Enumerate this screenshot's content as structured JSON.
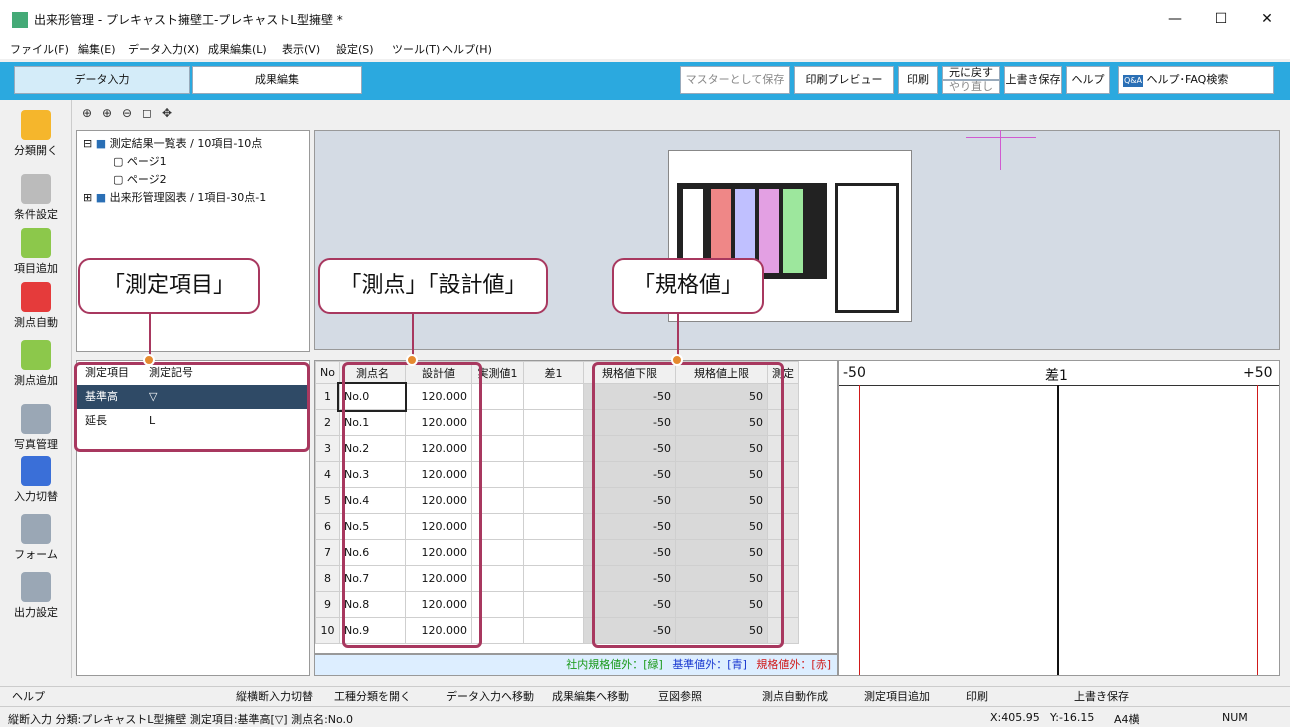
{
  "window": {
    "title": "出来形管理 - プレキャスト擁壁工-プレキャストL型擁壁 *"
  },
  "menu": [
    "ファイル(F)",
    "編集(E)",
    "データ入力(X)",
    "成果編集(L)",
    "表示(V)",
    "設定(S)",
    "ツール(T)",
    "ヘルプ(H)"
  ],
  "toolbar": {
    "tab_data_input": "データ入力",
    "tab_result_edit": "成果編集",
    "save_master": "マスターとして保存",
    "print_preview": "印刷プレビュー",
    "print": "印刷",
    "undo": "元に戻す",
    "redo": "やり直し",
    "overwrite_save": "上書き保存",
    "help": "ヘルプ",
    "faq_search": "ヘルプ･FAQ検索",
    "faq_badge": "Q&A"
  },
  "sidebar": [
    "分類開く",
    "条件設定",
    "項目追加",
    "測点自動",
    "測点追加",
    "写真管理",
    "入力切替",
    "フォーム",
    "出力設定"
  ],
  "tree": {
    "node1": "測定結果一覧表 / 10項目-10点",
    "page1": "ページ1",
    "page2": "ページ2",
    "node2": "出来形管理図表 / 1項目-30点-1"
  },
  "items": {
    "headers": [
      "測定項目",
      "測定記号"
    ],
    "rows": [
      [
        "基準高",
        "▽"
      ],
      [
        "延長",
        "L"
      ]
    ]
  },
  "grid": {
    "headers": [
      "No",
      "測点名",
      "設計値",
      "実測値1",
      "差1",
      "規格値下限",
      "規格値上限",
      "測定"
    ],
    "rows": [
      [
        "1",
        "No.0",
        "120.000",
        "",
        "",
        "-50",
        "50"
      ],
      [
        "2",
        "No.1",
        "120.000",
        "",
        "",
        "-50",
        "50"
      ],
      [
        "3",
        "No.2",
        "120.000",
        "",
        "",
        "-50",
        "50"
      ],
      [
        "4",
        "No.3",
        "120.000",
        "",
        "",
        "-50",
        "50"
      ],
      [
        "5",
        "No.4",
        "120.000",
        "",
        "",
        "-50",
        "50"
      ],
      [
        "6",
        "No.5",
        "120.000",
        "",
        "",
        "-50",
        "50"
      ],
      [
        "7",
        "No.6",
        "120.000",
        "",
        "",
        "-50",
        "50"
      ],
      [
        "8",
        "No.7",
        "120.000",
        "",
        "",
        "-50",
        "50"
      ],
      [
        "9",
        "No.8",
        "120.000",
        "",
        "",
        "-50",
        "50"
      ],
      [
        "10",
        "No.9",
        "120.000",
        "",
        "",
        "-50",
        "50"
      ]
    ]
  },
  "legend": {
    "green": "社内規格値外：[緑]",
    "blue": "基準値外：[青]",
    "red": "規格値外：[赤]"
  },
  "chart": {
    "left": "-50",
    "center": "差1",
    "right": "+50"
  },
  "callouts": {
    "item": "「測定項目」",
    "point": "「測点」「設計値」",
    "spec": "「規格値」"
  },
  "fnkeys": [
    "ヘルプ",
    "縦横断入力切替",
    "工種分類を開く",
    "データ入力へ移動",
    "成果編集へ移動",
    "豆図参照",
    "測点自動作成",
    "測定項目追加",
    "印刷",
    "上書き保存"
  ],
  "status": {
    "left": "縦断入力 分類:プレキャストL型擁壁 測定項目:基準高[▽] 測点名:No.0",
    "x": "X:405.95",
    "y": "Y:-16.15",
    "paper": "A4横",
    "num": "NUM"
  },
  "colors": {
    "accent": "#2ba9df",
    "callout_border": "#a8385f",
    "dot": "#e58a2f",
    "selected_row": "#2f4a66"
  }
}
